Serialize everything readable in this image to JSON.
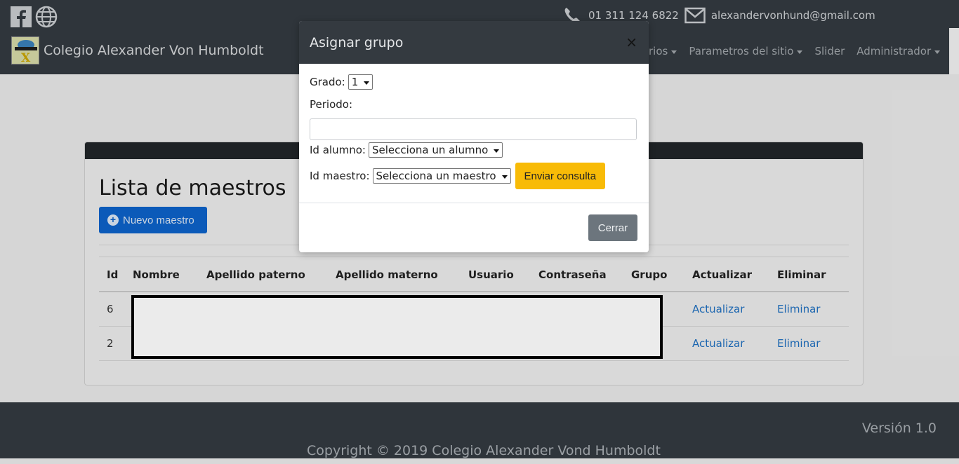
{
  "header": {
    "contact_phone": "01 311 124 6822",
    "contact_email": "alexandervonhund@gmail.com",
    "brand_name": "Colegio Alexander Von Humboldt",
    "nav_items": [
      {
        "label": "rios"
      },
      {
        "label": "Parametros del sitio"
      },
      {
        "label": "Slider"
      },
      {
        "label": "Administrador"
      }
    ]
  },
  "main": {
    "title": "Lista de maestros",
    "new_button_label": "Nuevo maestro",
    "table": {
      "columns": [
        "Id",
        "Nombre",
        "Apellido paterno",
        "Apellido materno",
        "Usuario",
        "Contraseña",
        "Grupo",
        "Actualizar",
        "Eliminar"
      ],
      "rows": [
        {
          "id": "6",
          "actualizar": "Actualizar",
          "eliminar": "Eliminar"
        },
        {
          "id": "2",
          "actualizar": "Actualizar",
          "eliminar": "Eliminar"
        }
      ]
    }
  },
  "modal": {
    "title": "Asignar grupo",
    "close_symbol": "×",
    "grado_label": "Grado:",
    "grado_value": "1",
    "periodo_label": "Periodo:",
    "periodo_value": "",
    "alumno_label": "Id alumno:",
    "alumno_value": "Selecciona un alumno",
    "maestro_label": "Id maestro:",
    "maestro_value": "Selecciona un maestro",
    "submit_label": "Enviar consulta",
    "cerrar_label": "Cerrar"
  },
  "footer": {
    "version": "Versión 1.0",
    "copyright": "Copyright © 2019 Colegio Alexander Vond Humboldt"
  },
  "colors": {
    "navbar": "#343a40",
    "primary": "#0d62c9",
    "warning": "#f8bb07",
    "secondary": "#6c757d",
    "link": "#1f6fbf"
  },
  "icons": [
    "facebook-icon",
    "globe-icon",
    "phone-icon",
    "mail-icon",
    "plus-circle-icon",
    "close-icon"
  ]
}
